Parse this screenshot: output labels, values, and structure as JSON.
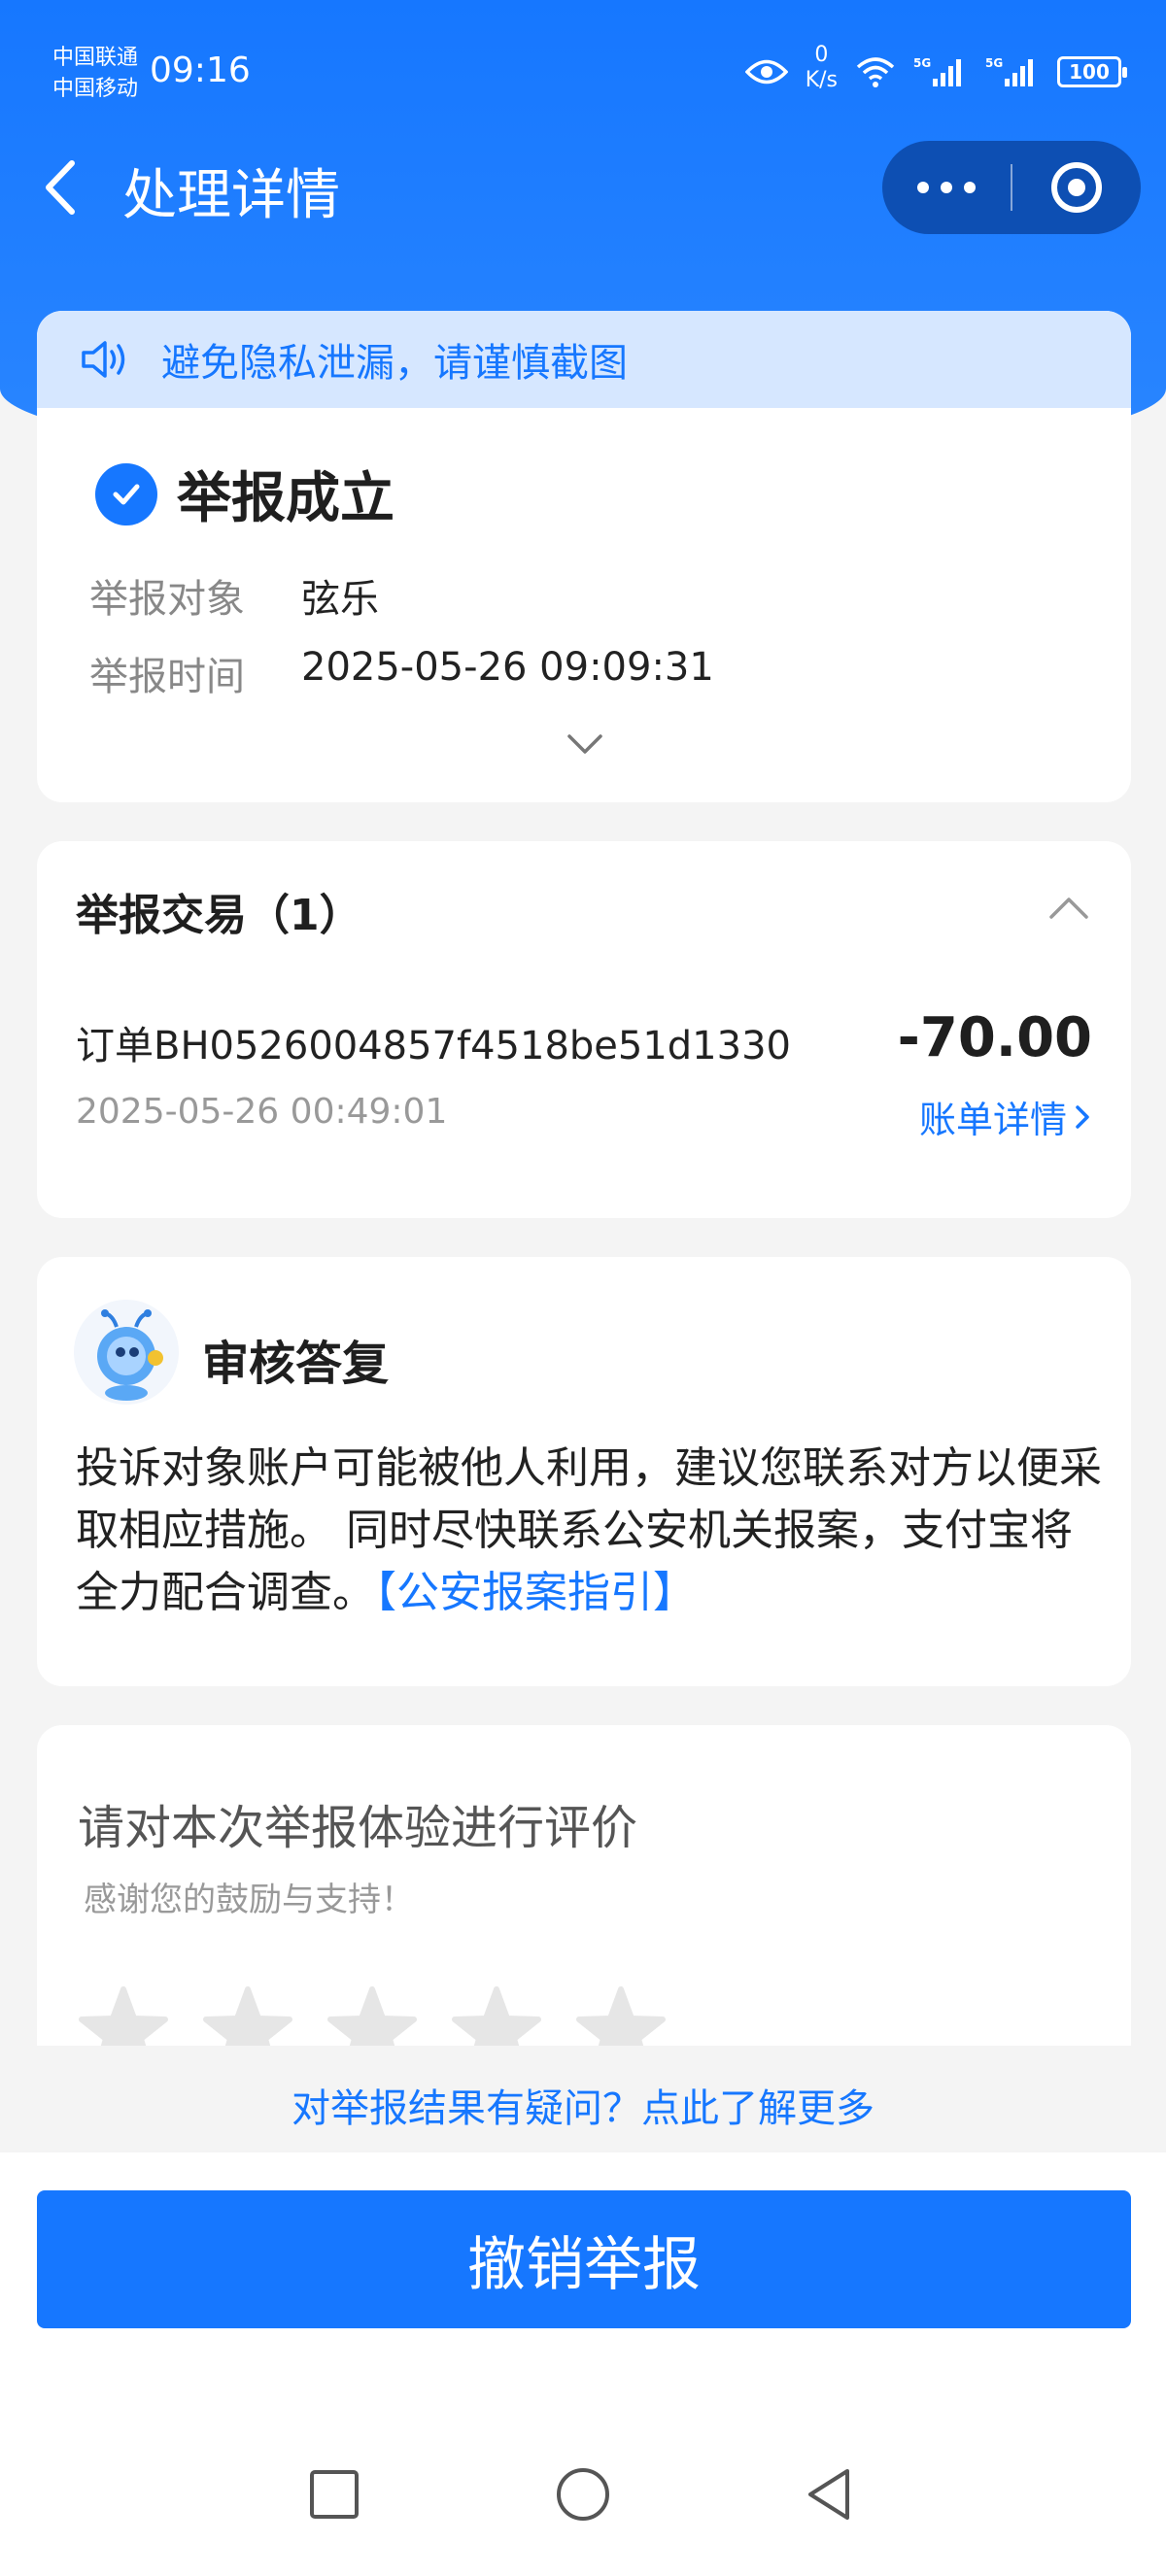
{
  "status_bar": {
    "carrier1": "中国联通",
    "carrier2": "中国移动",
    "time": "09:16",
    "net_speed_value": "0",
    "net_speed_unit": "K/s",
    "signal_label": "5G",
    "battery": "100"
  },
  "nav": {
    "title": "处理详情"
  },
  "notice": {
    "text": "避免隐私泄漏，请谨慎截图"
  },
  "result": {
    "title": "举报成立",
    "target_label": "举报对象",
    "target_value": "弦乐",
    "time_label": "举报时间",
    "time_value": "2025-05-26 09:09:31"
  },
  "transactions": {
    "title": "举报交易（1）",
    "items": [
      {
        "order": "订单BH0526004857f4518be51d1330",
        "amount": "-70.00",
        "time": "2025-05-26 00:49:01",
        "link": "账单详情"
      }
    ]
  },
  "review": {
    "title": "审核答复",
    "body": "投诉对象账户可能被他人利用，建议您联系对方以便采取相应措施。 同时尽快联系公安机关报案，支付宝将全力配合调查。",
    "link": "【公安报案指引】"
  },
  "rating": {
    "title": "请对本次举报体验进行评价",
    "subtitle": "感谢您的鼓励与支持！",
    "stars": 5
  },
  "faq_link": "对举报结果有疑问？点此了解更多",
  "cancel_button": "撤销举报",
  "colors": {
    "accent": "#1677ff",
    "notice_bg": "#d6e7ff",
    "capsule": "#0d4fb3"
  }
}
